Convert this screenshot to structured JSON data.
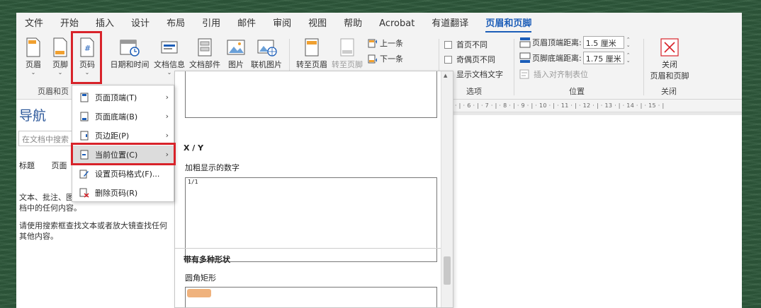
{
  "tabs": [
    "文件",
    "开始",
    "插入",
    "设计",
    "布局",
    "引用",
    "邮件",
    "审阅",
    "视图",
    "帮助",
    "Acrobat",
    "有道翻译",
    "页眉和页脚"
  ],
  "ribbon": {
    "header_label": "页眉",
    "footer_label": "页脚",
    "page_number_label": "页码",
    "datetime_label": "日期和时间",
    "docinfo_label": "文档信息",
    "docparts_label": "文档部件",
    "picture_label": "图片",
    "online_picture_label": "联机图片",
    "goto_header_label": "转至页眉",
    "goto_footer_label": "转至页脚",
    "prev_label": "上一条",
    "next_label": "下一条",
    "group_header_footer": "页眉和页",
    "options": {
      "first_page_diff": "首页不同",
      "odd_even_diff": "奇偶页不同",
      "show_doc_text": "显示文档文字",
      "group_label": "选项"
    },
    "position": {
      "header_dist_label": "页眉顶端距离:",
      "header_dist_value": "1.5 厘米",
      "footer_dist_label": "页脚底端距离:",
      "footer_dist_value": "1.75 厘米",
      "insert_align_tab": "插入对齐制表位",
      "group_label": "位置"
    },
    "close": {
      "label_line1": "关闭",
      "label_line2": "页眉和页脚",
      "group_label": "关闭"
    }
  },
  "nav": {
    "title": "导航",
    "search_placeholder": "在文档中搜索",
    "tab_headings": "标题",
    "tab_pages": "页面",
    "help_line1": "文本、批注、图",
    "help_line2": "档中的任何内容。",
    "help_line3": "请使用搜索框查找文本或者放大镜查找任何",
    "help_line4": "其他内容。"
  },
  "menu": {
    "items": [
      {
        "label": "页面顶端(T)",
        "arrow": "›"
      },
      {
        "label": "页面底端(B)",
        "arrow": "›"
      },
      {
        "label": "页边距(P)",
        "arrow": "›"
      },
      {
        "label": "当前位置(C)",
        "arrow": "›"
      },
      {
        "label": "设置页码格式(F)...",
        "arrow": ""
      },
      {
        "label": "删除页码(R)",
        "arrow": ""
      }
    ]
  },
  "gallery": {
    "section1_title": "X / Y",
    "section1_item": "加粗显示的数字",
    "section1_preview": "1/1",
    "section2_title": "带有多种形状",
    "section2_item": "圆角矩形"
  },
  "ruler_text": "· | · 6 · | · 7 · | · 8 · | · 9 · | · 10 · | · 11 · | · 12 · | · 13 · | · 14 · | · 15 · |",
  "colors": {
    "accent": "#1b5db8",
    "highlight_box": "#d8232a",
    "background": "#2f5a3c"
  }
}
